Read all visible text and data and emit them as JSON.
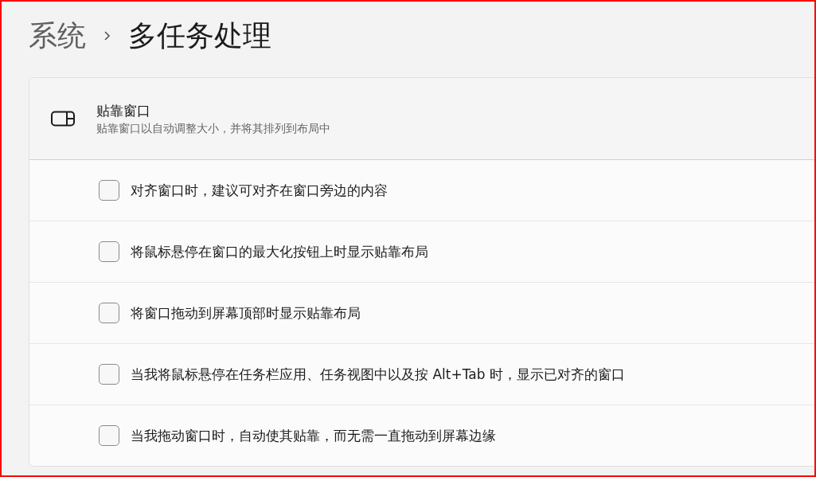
{
  "breadcrumb": {
    "parent": "系统",
    "current": "多任务处理"
  },
  "section": {
    "title": "贴靠窗口",
    "description": "贴靠窗口以自动调整大小，并将其排列到布局中",
    "options": [
      {
        "label": "对齐窗口时，建议可对齐在窗口旁边的内容",
        "checked": false
      },
      {
        "label": "将鼠标悬停在窗口的最大化按钮上时显示贴靠布局",
        "checked": false
      },
      {
        "label": "将窗口拖动到屏幕顶部时显示贴靠布局",
        "checked": false
      },
      {
        "label": "当我将鼠标悬停在任务栏应用、任务视图中以及按 Alt+Tab 时，显示已对齐的窗口",
        "checked": false
      },
      {
        "label": "当我拖动窗口时，自动使其贴靠，而无需一直拖动到屏幕边缘",
        "checked": false
      }
    ]
  }
}
